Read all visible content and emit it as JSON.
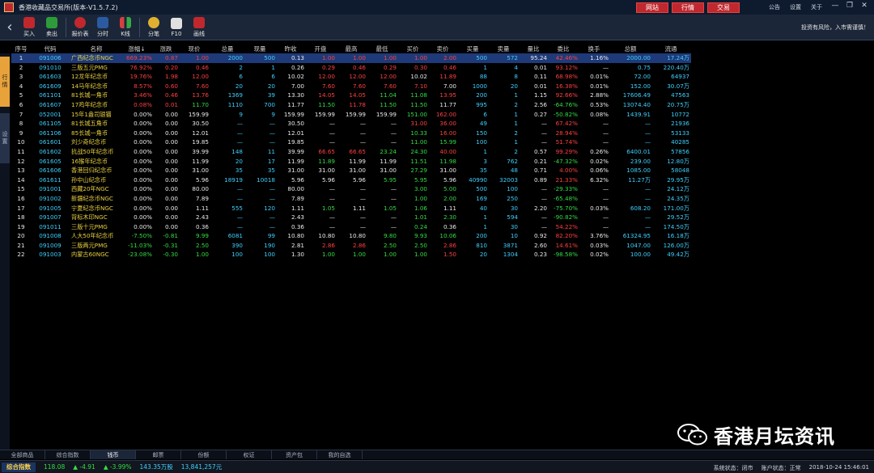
{
  "title_bar": {
    "app_title": "香港收藏品交易所(版本-V1.5.7.2)",
    "top_buttons": [
      "网站",
      "行情",
      "交易"
    ],
    "top_links": [
      "公告",
      "设置",
      "关于"
    ],
    "window_controls": [
      "—",
      "❐",
      "✕"
    ]
  },
  "toolbar": {
    "tools": [
      {
        "label": "买入",
        "icon": "buy-icon",
        "color": "#c0282d"
      },
      {
        "label": "卖出",
        "icon": "sell-icon",
        "color": "#2e9b3a"
      },
      {
        "label": "报价表",
        "icon": "quote-table-icon",
        "color": "#c0282d"
      },
      {
        "label": "分时",
        "icon": "timeshare-icon",
        "color": "#2b5aa0"
      },
      {
        "label": "K线",
        "icon": "kline-icon",
        "color": "#d84040"
      },
      {
        "label": "分笔",
        "icon": "tick-icon",
        "color": "#e0b030"
      },
      {
        "label": "F10",
        "icon": "f10-icon",
        "color": "#e0e0e0"
      },
      {
        "label": "画线",
        "icon": "draw-icon",
        "color": "#c0282d"
      }
    ],
    "risk_note": "投资有风险，入市需谨慎！"
  },
  "sidebar": {
    "active_tab": "行情",
    "other_tab": "设置"
  },
  "table": {
    "headers": [
      "序号",
      "代码",
      "名称",
      "涨幅↓",
      "涨跌",
      "现价",
      "总量",
      "现量",
      "昨收",
      "开盘",
      "最高",
      "最低",
      "买价",
      "卖价",
      "买量",
      "卖量",
      "量比",
      "委比",
      "换手",
      "总额",
      "流通"
    ],
    "rows": [
      [
        "1",
        "091006",
        "广西纪念币NGC",
        "669.23%",
        "0.87",
        "1.00",
        "2000",
        "500",
        "0.13",
        "1.00",
        "1.00",
        "1.00",
        "1.00",
        "2.00",
        "500",
        "572",
        "95.24",
        "42.46%",
        "1.16%",
        "2000.00",
        "17.24万"
      ],
      [
        "2",
        "091010",
        "三版五元PMG",
        "76.92%",
        "0.20",
        "0.46",
        "2",
        "1",
        "0.26",
        "0.29",
        "0.46",
        "0.29",
        "0.30",
        "0.46",
        "1",
        "4",
        "0.01",
        "93.12%",
        "—",
        "0.75",
        "220.40万"
      ],
      [
        "3",
        "061603",
        "12龙年纪念币",
        "19.76%",
        "1.98",
        "12.00",
        "6",
        "6",
        "10.02",
        "12.00",
        "12.00",
        "12.00",
        "10.02",
        "11.89",
        "88",
        "8",
        "0.11",
        "68.98%",
        "0.01%",
        "72.00",
        "64937"
      ],
      [
        "4",
        "061609",
        "14马年纪念币",
        "8.57%",
        "0.60",
        "7.60",
        "20",
        "20",
        "7.00",
        "7.60",
        "7.60",
        "7.60",
        "7.10",
        "7.00",
        "1000",
        "20",
        "0.01",
        "16.38%",
        "0.01%",
        "152.00",
        "30.07万"
      ],
      [
        "5",
        "061101",
        "81长城一角币",
        "3.46%",
        "0.46",
        "13.76",
        "1369",
        "39",
        "13.30",
        "14.05",
        "14.05",
        "11.04",
        "11.08",
        "13.95",
        "200",
        "1",
        "1.15",
        "92.66%",
        "2.88%",
        "17606.49",
        "47563"
      ],
      [
        "6",
        "061607",
        "17鸡年纪念币",
        "0.08%",
        "0.01",
        "11.70",
        "1110",
        "700",
        "11.77",
        "11.50",
        "11.78",
        "11.50",
        "11.50",
        "11.77",
        "995",
        "2",
        "2.56",
        "-64.76%",
        "0.53%",
        "13074.40",
        "20.75万"
      ],
      [
        "7",
        "052001",
        "15年1盎司银猫",
        "0.00%",
        "0.00",
        "159.99",
        "9",
        "9",
        "159.99",
        "159.99",
        "159.99",
        "159.99",
        "151.00",
        "162.00",
        "6",
        "1",
        "0.27",
        "-50.82%",
        "0.08%",
        "1439.91",
        "10772"
      ],
      [
        "8",
        "061105",
        "81长城五角币",
        "0.00%",
        "0.00",
        "30.50",
        "—",
        "—",
        "30.50",
        "—",
        "—",
        "—",
        "31.00",
        "36.00",
        "49",
        "1",
        "—",
        "67.42%",
        "—",
        "—",
        "21936"
      ],
      [
        "9",
        "061106",
        "85长城一角币",
        "0.00%",
        "0.00",
        "12.01",
        "—",
        "—",
        "12.01",
        "—",
        "—",
        "—",
        "10.33",
        "16.00",
        "150",
        "2",
        "—",
        "28.94%",
        "—",
        "—",
        "53133"
      ],
      [
        "10",
        "061601",
        "刘少奇纪念币",
        "0.00%",
        "0.00",
        "19.85",
        "—",
        "—",
        "19.85",
        "—",
        "—",
        "—",
        "11.00",
        "15.99",
        "100",
        "1",
        "—",
        "51.74%",
        "—",
        "—",
        "40285"
      ],
      [
        "11",
        "061602",
        "抗战50年纪念币",
        "0.00%",
        "0.00",
        "39.99",
        "148",
        "11",
        "39.99",
        "66.65",
        "66.65",
        "23.24",
        "24.30",
        "40.00",
        "1",
        "2",
        "0.57",
        "99.29%",
        "0.26%",
        "6400.01",
        "57856"
      ],
      [
        "12",
        "061605",
        "16猴年纪念币",
        "0.00%",
        "0.00",
        "11.99",
        "20",
        "17",
        "11.99",
        "11.89",
        "11.99",
        "11.99",
        "11.51",
        "11.98",
        "3",
        "762",
        "0.21",
        "-47.32%",
        "0.02%",
        "239.00",
        "12.80万"
      ],
      [
        "13",
        "061606",
        "香港回归纪念币",
        "0.00%",
        "0.00",
        "31.00",
        "35",
        "35",
        "31.00",
        "31.00",
        "31.00",
        "31.00",
        "27.29",
        "31.00",
        "35",
        "48",
        "0.71",
        "4.00%",
        "0.06%",
        "1085.00",
        "58048"
      ],
      [
        "14",
        "061611",
        "孙中山纪念币",
        "0.00%",
        "0.00",
        "5.96",
        "18919",
        "10018",
        "5.96",
        "5.96",
        "5.96",
        "5.95",
        "5.95",
        "5.96",
        "40990",
        "32003",
        "0.89",
        "21.33%",
        "6.32%",
        "11.27万",
        "29.95万"
      ],
      [
        "15",
        "091001",
        "西藏20年NGC",
        "0.00%",
        "0.00",
        "80.00",
        "—",
        "—",
        "80.00",
        "—",
        "—",
        "—",
        "3.00",
        "5.00",
        "500",
        "100",
        "—",
        "-29.33%",
        "—",
        "—",
        "24.12万"
      ],
      [
        "16",
        "091002",
        "新疆纪念币NGC",
        "0.00%",
        "0.00",
        "7.89",
        "—",
        "—",
        "7.89",
        "—",
        "—",
        "—",
        "1.00",
        "2.00",
        "169",
        "250",
        "—",
        "-65.48%",
        "—",
        "—",
        "24.35万"
      ],
      [
        "17",
        "091005",
        "宁夏纪念币NGC",
        "0.00%",
        "0.00",
        "1.11",
        "555",
        "120",
        "1.11",
        "1.05",
        "1.11",
        "1.05",
        "1.06",
        "1.11",
        "40",
        "30",
        "2.20",
        "-75.70%",
        "0.03%",
        "608.20",
        "171.00万"
      ],
      [
        "18",
        "091007",
        "背标木印NGC",
        "0.00%",
        "0.00",
        "2.43",
        "—",
        "—",
        "2.43",
        "—",
        "—",
        "—",
        "1.01",
        "2.30",
        "1",
        "594",
        "—",
        "-90.82%",
        "—",
        "—",
        "29.52万"
      ],
      [
        "19",
        "091011",
        "三版十元PMG",
        "0.00%",
        "0.00",
        "0.36",
        "—",
        "—",
        "0.36",
        "—",
        "—",
        "—",
        "0.24",
        "0.36",
        "1",
        "30",
        "—",
        "54.22%",
        "—",
        "—",
        "174.50万"
      ],
      [
        "20",
        "091008",
        "人大50年纪念币",
        "-7.50%",
        "-0.81",
        "9.99",
        "6081",
        "99",
        "10.80",
        "10.80",
        "10.80",
        "9.80",
        "9.93",
        "10.06",
        "200",
        "10",
        "0.92",
        "82.20%",
        "3.76%",
        "61324.95",
        "16.18万"
      ],
      [
        "21",
        "091009",
        "三版两元PMG",
        "-11.03%",
        "-0.31",
        "2.50",
        "390",
        "190",
        "2.81",
        "2.86",
        "2.86",
        "2.50",
        "2.50",
        "2.86",
        "810",
        "3871",
        "2.60",
        "14.61%",
        "0.03%",
        "1047.00",
        "126.00万"
      ],
      [
        "22",
        "091003",
        "内蒙古60NGC",
        "-23.08%",
        "-0.30",
        "1.00",
        "100",
        "100",
        "1.30",
        "1.00",
        "1.00",
        "1.00",
        "1.00",
        "1.50",
        "20",
        "1304",
        "0.23",
        "-98.58%",
        "0.02%",
        "100.00",
        "49.42万"
      ]
    ]
  },
  "bottom_tabs": [
    "全部商品",
    "综合指数",
    "钱币",
    "邮票",
    "份额",
    "权证",
    "资产包",
    "我的自选"
  ],
  "active_bottom_tab": "钱币",
  "status_bar": {
    "index_label": "综合指数",
    "index_value": "118.08",
    "change": "▲ -4.91",
    "change_pct": "▲ -3.99%",
    "volume": "143.35万股",
    "amount": "13,841,257元",
    "system_status": "系统状态：闭市",
    "account_status": "账户状态：正常",
    "datetime": "2018-10-24 15:46:01"
  },
  "watermark": {
    "text": "香港月坛资讯"
  },
  "colors": {
    "up": "#ff4040",
    "down": "#33dd44",
    "flat": "#eaeaea",
    "volume": "#3fd0ff",
    "name": "#e8d040",
    "selected_row": "#1e3a78",
    "accent": "#c0282d"
  }
}
